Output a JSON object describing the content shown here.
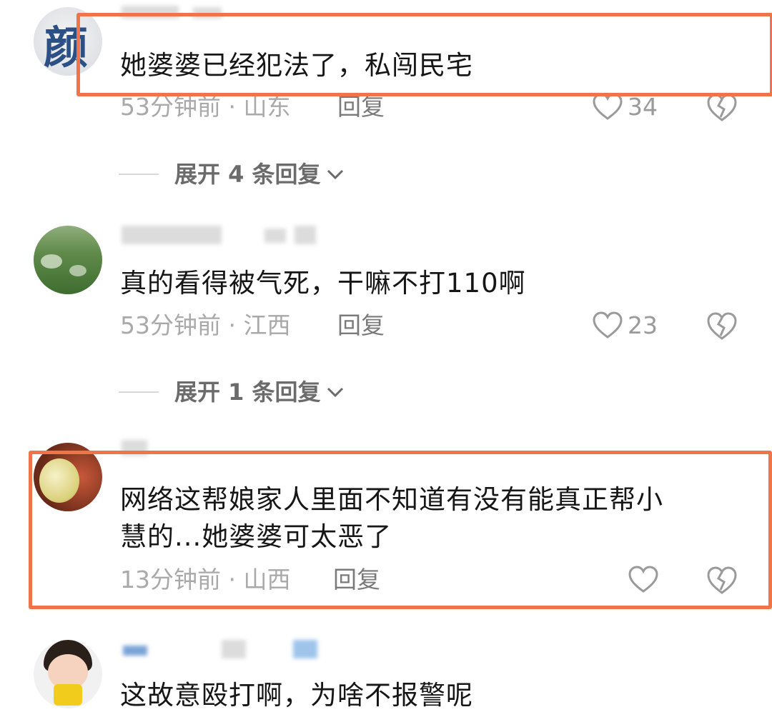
{
  "comments": [
    {
      "text": "她婆婆已经犯法了，私闯民宅",
      "time": "53分钟前",
      "location": "山东",
      "reply_label": "回复",
      "likes": "34",
      "expand": "展开 4 条回复",
      "avatar_text": "颜"
    },
    {
      "text": "真的看得被气死，干嘛不打110啊",
      "time": "53分钟前",
      "location": "江西",
      "reply_label": "回复",
      "likes": "23",
      "expand": "展开 1 条回复"
    },
    {
      "text_line1": "网络这帮娘家人里面不知道有没有能真正帮小",
      "text_line2": "慧的...她婆婆可太恶了",
      "time": "13分钟前",
      "location": "山西",
      "reply_label": "回复",
      "likes": ""
    },
    {
      "text": "这故意殴打啊，为啥不报警呢"
    }
  ],
  "meta_separator": "·",
  "colors": {
    "highlight": "#f0744a",
    "text": "#161616",
    "meta": "#a9a9a9"
  }
}
